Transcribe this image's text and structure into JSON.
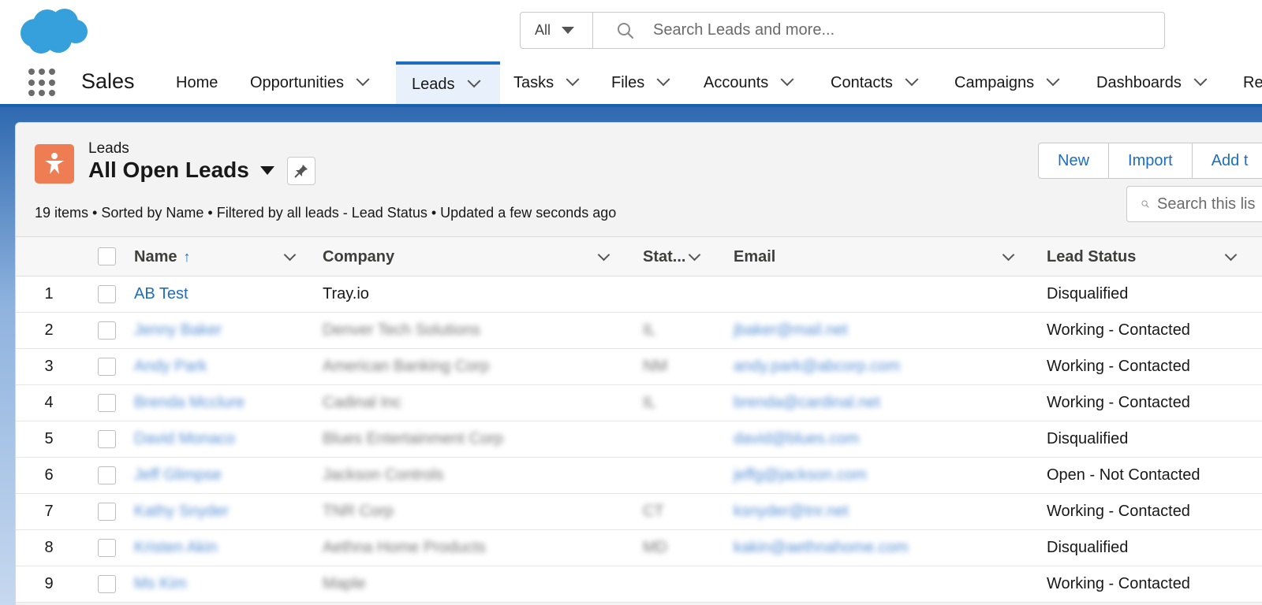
{
  "header": {
    "search_scope": "All",
    "search_placeholder": "Search Leads and more..."
  },
  "nav": {
    "app_name": "Sales",
    "items": [
      {
        "label": "Home",
        "has_menu": false,
        "active": false
      },
      {
        "label": "Opportunities",
        "has_menu": true,
        "active": false
      },
      {
        "label": "Leads",
        "has_menu": true,
        "active": true
      },
      {
        "label": "Tasks",
        "has_menu": true,
        "active": false
      },
      {
        "label": "Files",
        "has_menu": true,
        "active": false
      },
      {
        "label": "Accounts",
        "has_menu": true,
        "active": false
      },
      {
        "label": "Contacts",
        "has_menu": true,
        "active": false
      },
      {
        "label": "Campaigns",
        "has_menu": true,
        "active": false
      },
      {
        "label": "Dashboards",
        "has_menu": true,
        "active": false
      },
      {
        "label": "Re",
        "has_menu": false,
        "active": false
      }
    ]
  },
  "list": {
    "object_label": "Leads",
    "view_name": "All Open Leads",
    "meta": "19 items • Sorted by Name • Filtered by all leads - Lead Status • Updated a few seconds ago",
    "buttons": {
      "new": "New",
      "import": "Import",
      "add": "Add t"
    },
    "search_placeholder": "Search this lis"
  },
  "table": {
    "columns": {
      "name": "Name",
      "company": "Company",
      "state": "Stat...",
      "email": "Email",
      "lead_status": "Lead Status"
    },
    "rows": [
      {
        "num": "1",
        "name": "AB Test",
        "company": "Tray.io",
        "state": "",
        "email": "",
        "status": "Disqualified"
      },
      {
        "num": "2",
        "name": "Jenny Baker",
        "company": "Denver Tech Solutions",
        "state": "IL",
        "email": "jbaker@mail.net",
        "status": "Working - Contacted"
      },
      {
        "num": "3",
        "name": "Andy Park",
        "company": "American Banking Corp",
        "state": "NM",
        "email": "andy.park@abcorp.com",
        "status": "Working - Contacted"
      },
      {
        "num": "4",
        "name": "Brenda Mcclure",
        "company": "Cadinal Inc",
        "state": "IL",
        "email": "brenda@cardinal.net",
        "status": "Working - Contacted"
      },
      {
        "num": "5",
        "name": "David Monaco",
        "company": "Blues Entertainment Corp",
        "state": "",
        "email": "david@blues.com",
        "status": "Disqualified"
      },
      {
        "num": "6",
        "name": "Jeff Glimpse",
        "company": "Jackson Controls",
        "state": "",
        "email": "jeffg@jackson.com",
        "status": "Open - Not Contacted"
      },
      {
        "num": "7",
        "name": "Kathy Snyder",
        "company": "TNR Corp",
        "state": "CT",
        "email": "ksnyder@tnr.net",
        "status": "Working - Contacted"
      },
      {
        "num": "8",
        "name": "Kristen Akin",
        "company": "Aethna Home Products",
        "state": "MD",
        "email": "kakin@aethnahome.com",
        "status": "Disqualified"
      },
      {
        "num": "9",
        "name": "Ms Kim",
        "company": "Maple",
        "state": "",
        "email": "",
        "status": "Working - Contacted"
      }
    ]
  }
}
